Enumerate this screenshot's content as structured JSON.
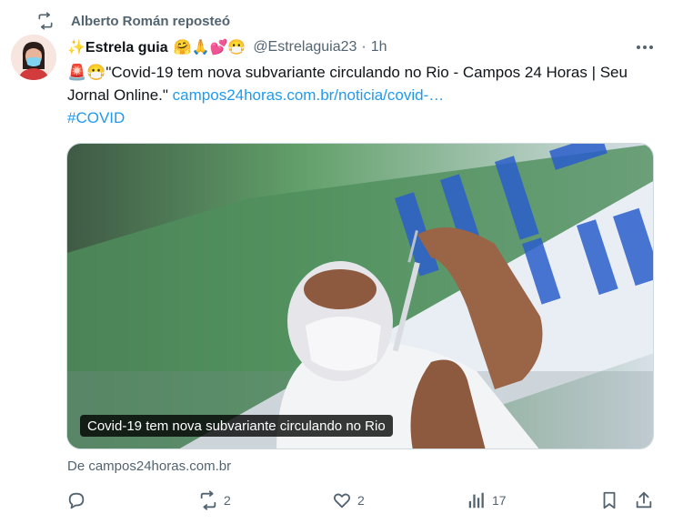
{
  "repost": {
    "label": "Alberto Román reposteó",
    "icon": "repost-icon"
  },
  "author": {
    "display_name": "✨Estrela guia",
    "name_emojis": "🤗🙏💕😷",
    "handle": "@Estrelaguia23",
    "separator": "·",
    "time": "1h"
  },
  "tweet": {
    "text_prefix": "🚨😷\"Covid-19 tem nova subvariante circulando no Rio - Campos 24 Horas | Seu Jornal Online.\"",
    "link_text": "campos24horas.com.br/noticia/covid-…",
    "hashtag": "#COVID"
  },
  "card": {
    "caption": "Covid-19 tem nova subvariante circulando no Rio",
    "source": "De campos24horas.com.br"
  },
  "actions": {
    "reply": {
      "icon": "reply-icon",
      "count": ""
    },
    "repost": {
      "icon": "repost-icon",
      "count": "2"
    },
    "like": {
      "icon": "heart-icon",
      "count": "2"
    },
    "views": {
      "icon": "views-icon",
      "count": "17"
    },
    "bookmark": {
      "icon": "bookmark-icon"
    },
    "share": {
      "icon": "share-icon"
    }
  },
  "colors": {
    "accent": "#1d9bf0",
    "secondary_text": "#536471",
    "text": "#0f1419"
  }
}
